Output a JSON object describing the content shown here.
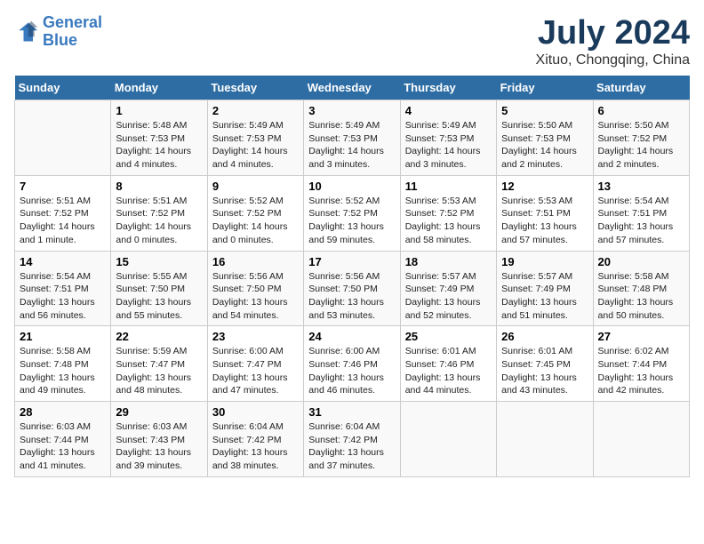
{
  "header": {
    "logo_line1": "General",
    "logo_line2": "Blue",
    "main_title": "July 2024",
    "subtitle": "Xituo, Chongqing, China"
  },
  "calendar": {
    "days_of_week": [
      "Sunday",
      "Monday",
      "Tuesday",
      "Wednesday",
      "Thursday",
      "Friday",
      "Saturday"
    ],
    "weeks": [
      [
        {
          "day": "",
          "info": ""
        },
        {
          "day": "1",
          "info": "Sunrise: 5:48 AM\nSunset: 7:53 PM\nDaylight: 14 hours\nand 4 minutes."
        },
        {
          "day": "2",
          "info": "Sunrise: 5:49 AM\nSunset: 7:53 PM\nDaylight: 14 hours\nand 4 minutes."
        },
        {
          "day": "3",
          "info": "Sunrise: 5:49 AM\nSunset: 7:53 PM\nDaylight: 14 hours\nand 3 minutes."
        },
        {
          "day": "4",
          "info": "Sunrise: 5:49 AM\nSunset: 7:53 PM\nDaylight: 14 hours\nand 3 minutes."
        },
        {
          "day": "5",
          "info": "Sunrise: 5:50 AM\nSunset: 7:53 PM\nDaylight: 14 hours\nand 2 minutes."
        },
        {
          "day": "6",
          "info": "Sunrise: 5:50 AM\nSunset: 7:52 PM\nDaylight: 14 hours\nand 2 minutes."
        }
      ],
      [
        {
          "day": "7",
          "info": "Sunrise: 5:51 AM\nSunset: 7:52 PM\nDaylight: 14 hours\nand 1 minute."
        },
        {
          "day": "8",
          "info": "Sunrise: 5:51 AM\nSunset: 7:52 PM\nDaylight: 14 hours\nand 0 minutes."
        },
        {
          "day": "9",
          "info": "Sunrise: 5:52 AM\nSunset: 7:52 PM\nDaylight: 14 hours\nand 0 minutes."
        },
        {
          "day": "10",
          "info": "Sunrise: 5:52 AM\nSunset: 7:52 PM\nDaylight: 13 hours\nand 59 minutes."
        },
        {
          "day": "11",
          "info": "Sunrise: 5:53 AM\nSunset: 7:52 PM\nDaylight: 13 hours\nand 58 minutes."
        },
        {
          "day": "12",
          "info": "Sunrise: 5:53 AM\nSunset: 7:51 PM\nDaylight: 13 hours\nand 57 minutes."
        },
        {
          "day": "13",
          "info": "Sunrise: 5:54 AM\nSunset: 7:51 PM\nDaylight: 13 hours\nand 57 minutes."
        }
      ],
      [
        {
          "day": "14",
          "info": "Sunrise: 5:54 AM\nSunset: 7:51 PM\nDaylight: 13 hours\nand 56 minutes."
        },
        {
          "day": "15",
          "info": "Sunrise: 5:55 AM\nSunset: 7:50 PM\nDaylight: 13 hours\nand 55 minutes."
        },
        {
          "day": "16",
          "info": "Sunrise: 5:56 AM\nSunset: 7:50 PM\nDaylight: 13 hours\nand 54 minutes."
        },
        {
          "day": "17",
          "info": "Sunrise: 5:56 AM\nSunset: 7:50 PM\nDaylight: 13 hours\nand 53 minutes."
        },
        {
          "day": "18",
          "info": "Sunrise: 5:57 AM\nSunset: 7:49 PM\nDaylight: 13 hours\nand 52 minutes."
        },
        {
          "day": "19",
          "info": "Sunrise: 5:57 AM\nSunset: 7:49 PM\nDaylight: 13 hours\nand 51 minutes."
        },
        {
          "day": "20",
          "info": "Sunrise: 5:58 AM\nSunset: 7:48 PM\nDaylight: 13 hours\nand 50 minutes."
        }
      ],
      [
        {
          "day": "21",
          "info": "Sunrise: 5:58 AM\nSunset: 7:48 PM\nDaylight: 13 hours\nand 49 minutes."
        },
        {
          "day": "22",
          "info": "Sunrise: 5:59 AM\nSunset: 7:47 PM\nDaylight: 13 hours\nand 48 minutes."
        },
        {
          "day": "23",
          "info": "Sunrise: 6:00 AM\nSunset: 7:47 PM\nDaylight: 13 hours\nand 47 minutes."
        },
        {
          "day": "24",
          "info": "Sunrise: 6:00 AM\nSunset: 7:46 PM\nDaylight: 13 hours\nand 46 minutes."
        },
        {
          "day": "25",
          "info": "Sunrise: 6:01 AM\nSunset: 7:46 PM\nDaylight: 13 hours\nand 44 minutes."
        },
        {
          "day": "26",
          "info": "Sunrise: 6:01 AM\nSunset: 7:45 PM\nDaylight: 13 hours\nand 43 minutes."
        },
        {
          "day": "27",
          "info": "Sunrise: 6:02 AM\nSunset: 7:44 PM\nDaylight: 13 hours\nand 42 minutes."
        }
      ],
      [
        {
          "day": "28",
          "info": "Sunrise: 6:03 AM\nSunset: 7:44 PM\nDaylight: 13 hours\nand 41 minutes."
        },
        {
          "day": "29",
          "info": "Sunrise: 6:03 AM\nSunset: 7:43 PM\nDaylight: 13 hours\nand 39 minutes."
        },
        {
          "day": "30",
          "info": "Sunrise: 6:04 AM\nSunset: 7:42 PM\nDaylight: 13 hours\nand 38 minutes."
        },
        {
          "day": "31",
          "info": "Sunrise: 6:04 AM\nSunset: 7:42 PM\nDaylight: 13 hours\nand 37 minutes."
        },
        {
          "day": "",
          "info": ""
        },
        {
          "day": "",
          "info": ""
        },
        {
          "day": "",
          "info": ""
        }
      ]
    ]
  }
}
